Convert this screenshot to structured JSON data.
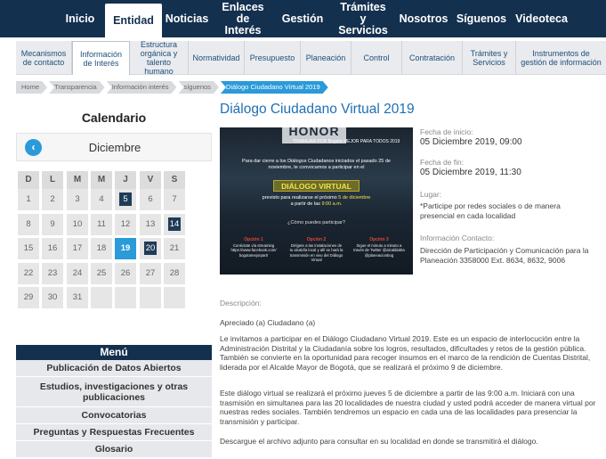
{
  "topnav": {
    "items": [
      "Inicio",
      "Entidad",
      "Noticias",
      "Enlaces de Interés",
      "Gestión",
      "Trámites y Servicios",
      "Nosotros",
      "Síguenos",
      "Videoteca"
    ]
  },
  "subnav": {
    "items": [
      "Mecanismos de contacto",
      "Información de Interés",
      "Estructura orgánica y talento humano",
      "Normatividad",
      "Presupuesto",
      "Planeación",
      "Control",
      "Contratación",
      "Trámites y Servicios",
      "Instrumentos de gestión de información"
    ]
  },
  "breadcrumb": [
    "Home",
    "Transparencia",
    "Información interés",
    "síguenos",
    "Diálogo Ciudadano Virtual 2019"
  ],
  "calendar": {
    "title": "Calendario",
    "month": "Diciembre",
    "prev_icon": "‹",
    "weekdays": [
      "D",
      "L",
      "M",
      "M",
      "J",
      "V",
      "S"
    ],
    "weeks": [
      [
        "1",
        "2",
        "3",
        "4",
        "5",
        "6",
        "7"
      ],
      [
        "8",
        "9",
        "10",
        "11",
        "12",
        "13",
        "14"
      ],
      [
        "15",
        "16",
        "17",
        "18",
        "19",
        "20",
        "21"
      ],
      [
        "22",
        "23",
        "24",
        "25",
        "26",
        "27",
        "28"
      ],
      [
        "29",
        "30",
        "31",
        "",
        "",
        "",
        ""
      ]
    ],
    "event_days": [
      "5",
      "14",
      "20"
    ],
    "today": "19"
  },
  "menu": {
    "title": "Menú",
    "items": [
      "Publicación de Datos Abiertos",
      "Estudios, investigaciones y otras publicaciones",
      "Convocatorias",
      "Preguntas y Respuestas Frecuentes",
      "Glosario"
    ]
  },
  "event": {
    "title": "Diálogo Ciudadano Virtual 2019",
    "image": {
      "brand": "HONOR",
      "brand_sub": "TRABAJAR POR Bogotá MEJOR PARA TODOS",
      "brand_year": "2019",
      "intro": "Para dar cierre a los Diálogos Ciudadanos iniciados el pasado 25 de noviembre, te convocamos a participar en el",
      "banner": "DIÁLOGO VIRTUAL",
      "when_pre": "previsto para realizarse el próximo",
      "when_date": "5 de diciembre",
      "when_mid": "a partir de las",
      "when_time": "9:00 a.m.",
      "question": "¿Cómo puedes participar?",
      "steps": [
        {
          "title": "Opción 1",
          "text": "Conéctate vía streaming https://www.facebook.com/ bogotamejorpart/"
        },
        {
          "title": "Opción 2",
          "text": "Dirígete a las instalaciones de tu alcaldía local y allí se hará la transmisión en vivo del Diálogo Virtual"
        },
        {
          "title": "Opción 3",
          "text": "Sigue el minuto a minuto a través de Twitter @alcaldiabta @planeacionbog"
        }
      ]
    },
    "start_label": "Fecha de inicio:",
    "start_value": "05 Diciembre 2019, 09:00",
    "end_label": "Fecha de fin:",
    "end_value": "05 Diciembre 2019, 11:30",
    "place_label": "Lugar:",
    "place_value": "*Participe por redes sociales o de manera presencial en cada localidad",
    "contact_label": "Información Contacto:",
    "contact_value": "Dirección de Participación y Comunicación para la Planeación 3358000 Ext. 8634, 8632, 9006",
    "description_label": "Descripción:",
    "paragraphs": [
      "Apreciado (a) Ciudadano (a)",
      "Le invitamos a participar en el Diálogo Ciudadano Virtual 2019. Este es un espacio de interlocución entre la Administración Distrital y la Ciudadanía sobre los logros, resultados, dificultades y retos de la gestión pública. También se convierte en la oportunidad para recoger insumos en el marco de la rendición de Cuentas Distrital, liderada por el Alcalde Mayor de Bogotá, que se realizará el próximo 9 de diciembre.",
      "Este diálogo virtual se realizará el próximo jueves 5 de diciembre a partir de las 9:00 a.m. Iniciará con una trasmisión en simultanea para las 20 localidades de nuestra ciudad y usted podrá acceder de manera virtual por nuestras redes sociales. También tendremos un espacio en cada una de las localidades para presenciar la transmisión y participar.",
      "Descargue el archivo adjunto para consultar en su localidad en donde se transmitirá el diálogo."
    ]
  },
  "colors": {
    "navy": "#14304f",
    "accent_blue": "#2a9ad9",
    "title_blue": "#1f6fb2"
  }
}
